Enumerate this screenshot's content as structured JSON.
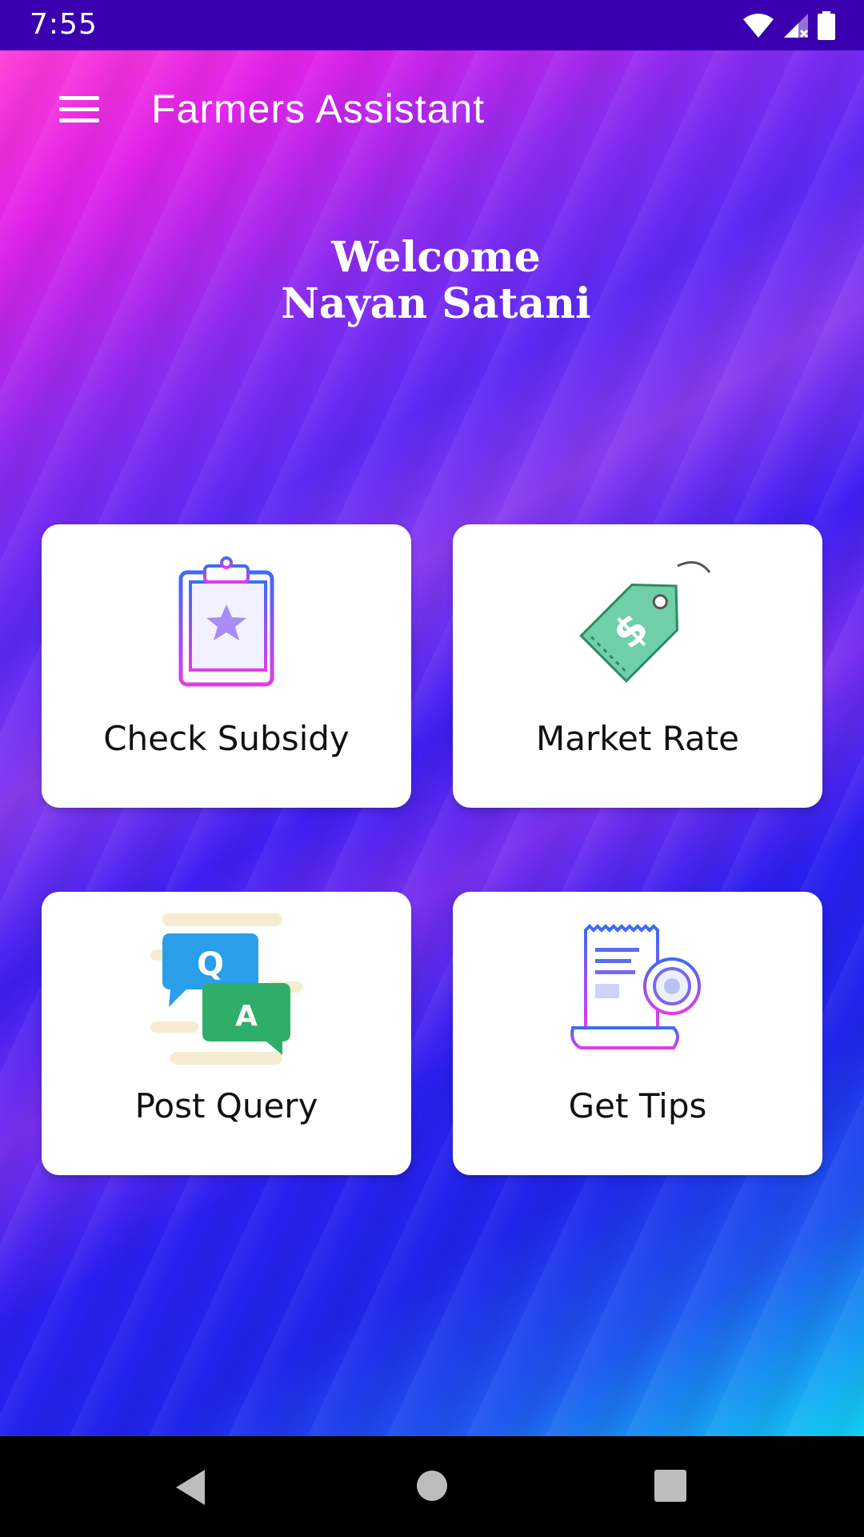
{
  "status_bar": {
    "time": "7:55",
    "icons": [
      "wifi-icon",
      "signal-icon",
      "battery-icon"
    ]
  },
  "app_bar": {
    "title": "Farmers Assistant",
    "menu_icon": "menu-icon"
  },
  "welcome": {
    "line1": "Welcome",
    "line2": "Nayan Satani"
  },
  "cards": [
    {
      "label": "Check Subsidy",
      "icon": "clipboard-star-icon"
    },
    {
      "label": "Market Rate",
      "icon": "price-tag-icon"
    },
    {
      "label": "Post Query",
      "icon": "qa-chat-icon"
    },
    {
      "label": "Get Tips",
      "icon": "receipt-coin-icon"
    }
  ],
  "nav_bar": {
    "icons": [
      "back-icon",
      "home-icon",
      "recents-icon"
    ]
  },
  "colors": {
    "status_bar": "#3a00b0",
    "gradient_start": "#ff3ed6",
    "gradient_mid": "#3d1ff2",
    "gradient_end": "#12d2f4",
    "card_bg": "#ffffff",
    "card_text": "#111111"
  }
}
